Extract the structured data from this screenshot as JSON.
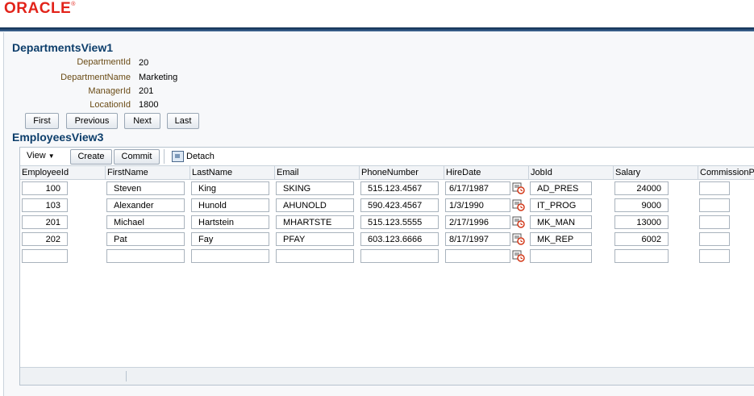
{
  "brand": {
    "logo_text": "ORACLE"
  },
  "departments": {
    "title": "DepartmentsView1",
    "fields": [
      {
        "label": "DepartmentId",
        "value": "20"
      },
      {
        "label": "DepartmentName",
        "value": "Marketing"
      },
      {
        "label": "ManagerId",
        "value": "201"
      },
      {
        "label": "LocationId",
        "value": "1800"
      }
    ],
    "nav": {
      "first": "First",
      "previous": "Previous",
      "next": "Next",
      "last": "Last"
    }
  },
  "employees": {
    "title": "EmployeesView3",
    "toolbar": {
      "view": "View",
      "create": "Create",
      "commit": "Commit",
      "detach": "Detach"
    },
    "columns": [
      "EmployeeId",
      "FirstName",
      "LastName",
      "Email",
      "PhoneNumber",
      "HireDate",
      "JobId",
      "Salary",
      "CommissionPct"
    ],
    "rows": [
      [
        "100",
        "Steven",
        "King",
        "SKING",
        "515.123.4567",
        "6/17/1987",
        "AD_PRES",
        "24000",
        ""
      ],
      [
        "103",
        "Alexander",
        "Hunold",
        "AHUNOLD",
        "590.423.4567",
        "1/3/1990",
        "IT_PROG",
        "9000",
        ""
      ],
      [
        "201",
        "Michael",
        "Hartstein",
        "MHARTSTE",
        "515.123.5555",
        "2/17/1996",
        "MK_MAN",
        "13000",
        ""
      ],
      [
        "202",
        "Pat",
        "Fay",
        "PFAY",
        "603.123.6666",
        "8/17/1997",
        "MK_REP",
        "6002",
        ""
      ],
      [
        "",
        "",
        "",
        "",
        "",
        "",
        "",
        "",
        ""
      ]
    ]
  }
}
